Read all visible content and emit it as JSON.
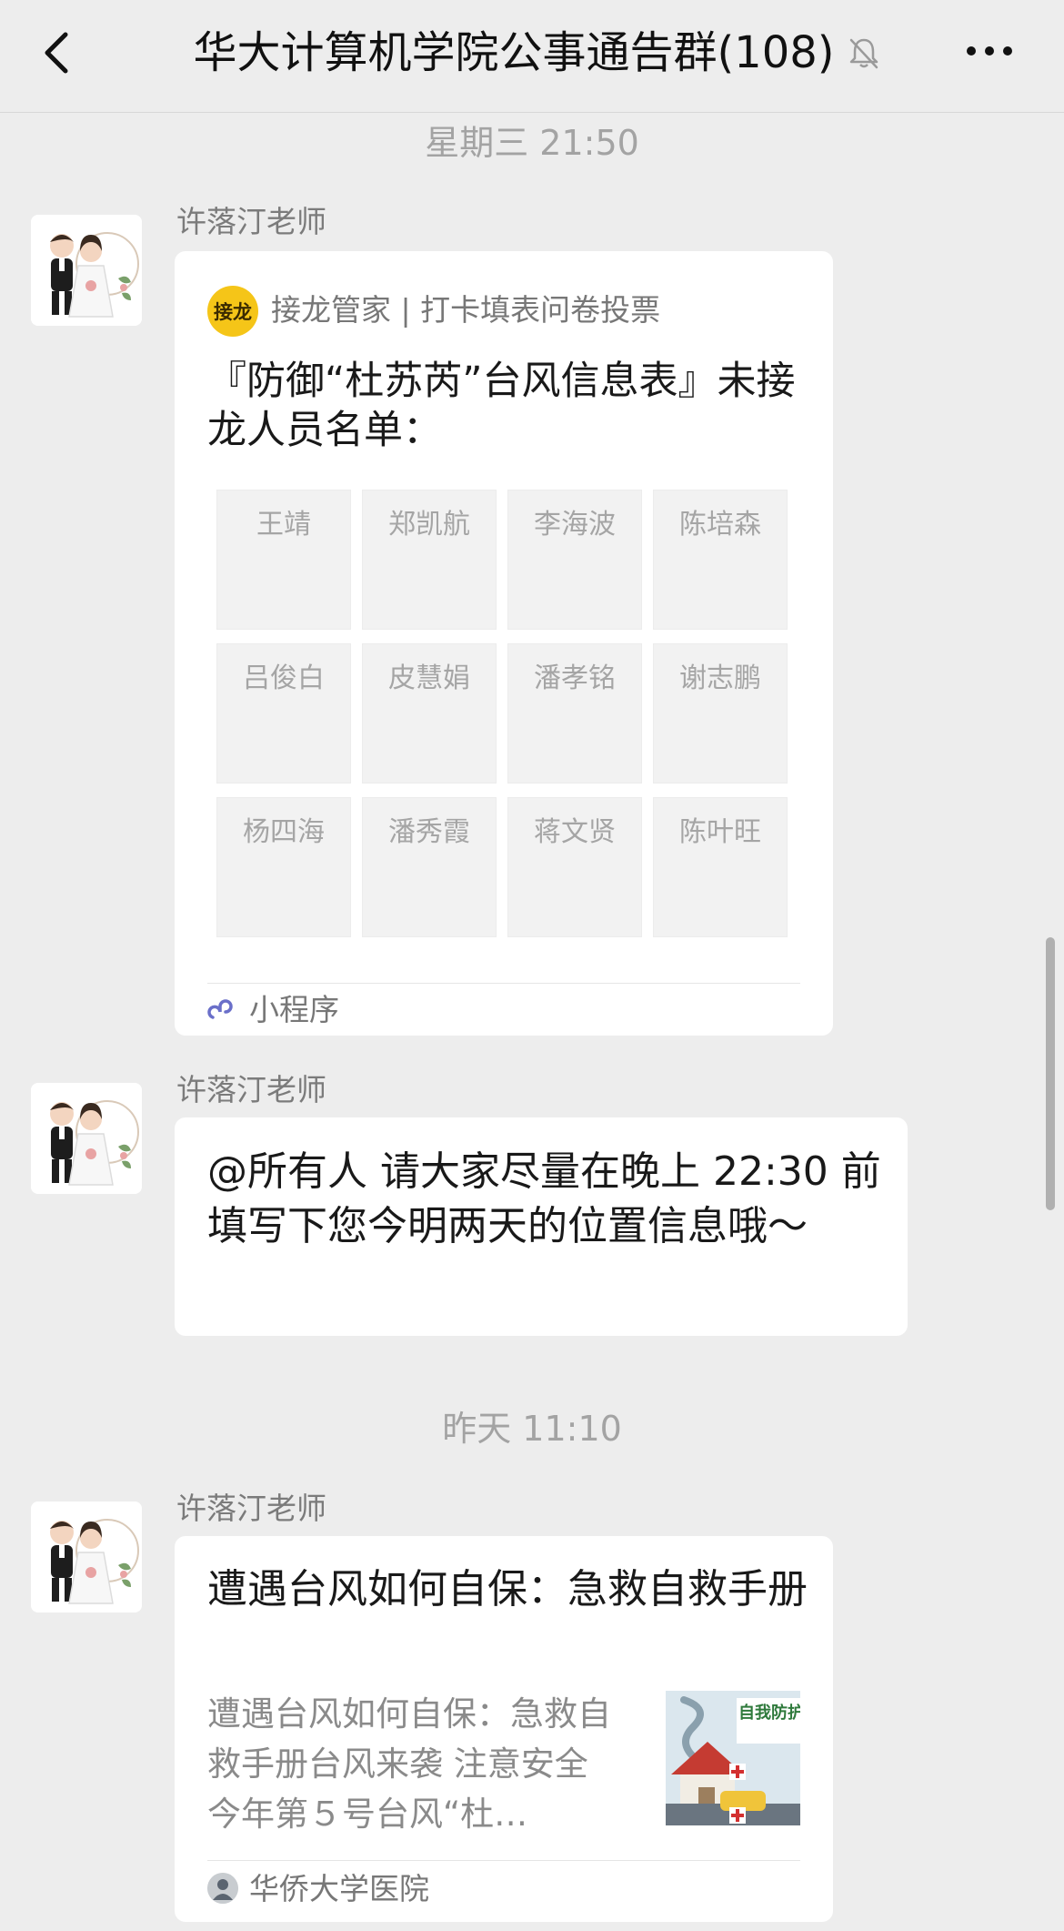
{
  "header": {
    "title": "华大计算机学院公事通告群(108)",
    "mute_icon": "bell-slash-icon",
    "back_icon": "chevron-left-icon",
    "more_icon": "ellipsis-icon"
  },
  "messages": {
    "timestamp1": "星期三 21:50",
    "m1": {
      "sender": "许落汀老师",
      "source_logo": "接龙",
      "source": "接龙管家 | 打卡填表问卷投票",
      "title": "『防御“杜苏芮”台风信息表』未接龙人员名单：",
      "names": [
        "王靖",
        "郑凯航",
        "李海波",
        "陈培森",
        "吕俊白",
        "皮慧娟",
        "潘孝铭",
        "谢志鹏",
        "杨四海",
        "潘秀霞",
        "蒋文贤",
        "陈叶旺"
      ],
      "footer": "小程序"
    },
    "m2": {
      "sender": "许落汀老师",
      "text": "@所有人 请大家尽量在晚上 22:30 前填写下您今明两天的位置信息哦～"
    },
    "timestamp2": "昨天 11:10",
    "m3": {
      "sender": "许落汀老师",
      "title": "遭遇台风如何自保：急救自救手册",
      "desc": "遭遇台风如何自保：急救自救手册台风来袭 注意安全　今年第５号台风“杜…",
      "thumb_text": "自我防护急救知识",
      "source": "华侨大学医院"
    }
  },
  "colors": {
    "background": "#ededed",
    "bubble": "#ffffff",
    "accent_logo": "#f5c518",
    "miniprogram_icon": "#6a6fc9"
  }
}
